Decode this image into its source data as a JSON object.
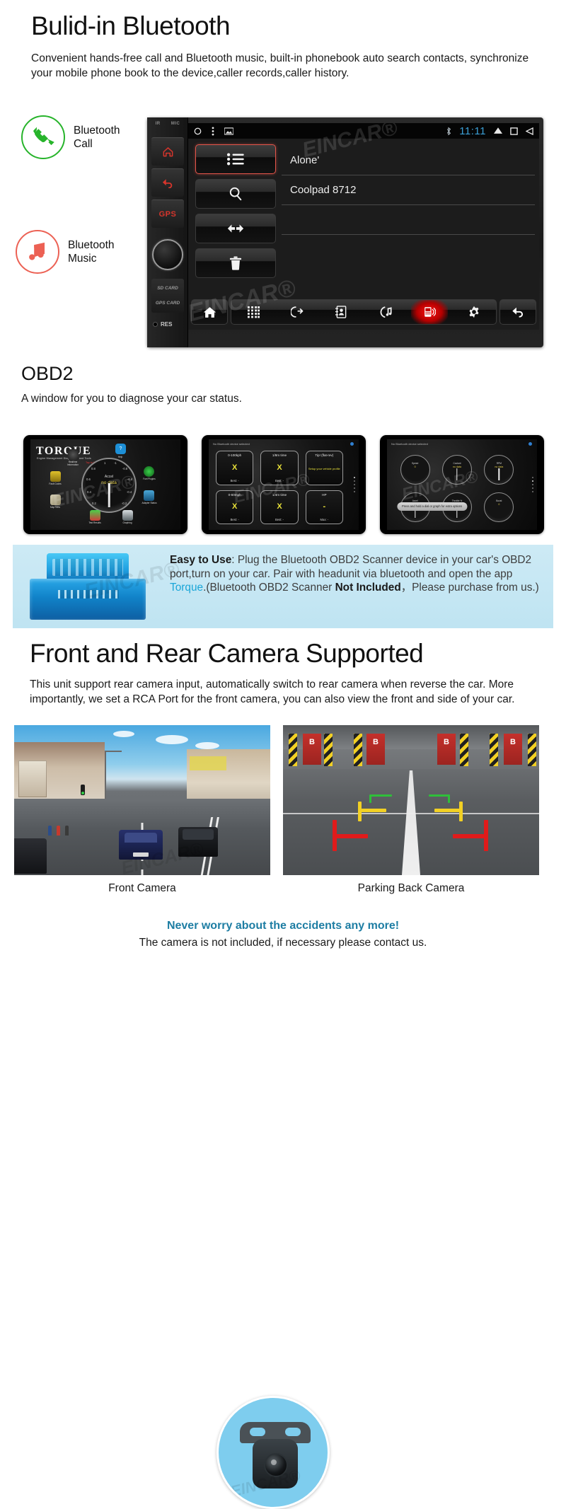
{
  "bluetooth": {
    "title": "Bulid-in Bluetooth",
    "description": "Convenient hands-free call and Bluetooth music, built-in phonebook auto search contacts, synchronize your mobile phone book to the device,caller records,caller history.",
    "features": [
      {
        "icon": "phone-handset-icon",
        "label": "Bluetooth\nCall",
        "color": "#27b42b"
      },
      {
        "icon": "music-note-icon",
        "label": "Bluetooth\nMusic",
        "color": "#ec6154"
      }
    ]
  },
  "head_unit": {
    "side_labels": {
      "ir": "IR",
      "mic": "MIC"
    },
    "hw_buttons": [
      {
        "name": "home-hw-button",
        "icon": "home-icon",
        "label": ""
      },
      {
        "name": "back-hw-button",
        "icon": "back-arrow-icon",
        "label": ""
      },
      {
        "name": "gps-hw-button",
        "icon": "",
        "label": "GPS"
      }
    ],
    "card_slots": [
      "SD CARD",
      "GPS CARD"
    ],
    "reset_label": "RES",
    "status_bar": {
      "left_icons": [
        "circle-icon",
        "more-vertical-icon",
        "gallery-icon"
      ],
      "bluetooth_icon": "bluetooth-icon",
      "time": "11:11",
      "right_icons": [
        "triangle-up-icon",
        "square-icon",
        "triangle-back-icon"
      ]
    },
    "tiles": [
      {
        "name": "paired-list-tile",
        "icon": "list-icon",
        "selected": true
      },
      {
        "name": "search-tile",
        "icon": "search-icon",
        "selected": false
      },
      {
        "name": "pair-tile",
        "icon": "pair-icon",
        "selected": false
      },
      {
        "name": "delete-tile",
        "icon": "trash-icon",
        "selected": false
      }
    ],
    "device_list": [
      "Alone'",
      "Coolpad 8712",
      ""
    ],
    "nav_bar": {
      "home": "home-icon",
      "back": "back-arrow-icon",
      "items": [
        {
          "name": "keypad-nav-icon",
          "icon": "keypad-icon",
          "active": false
        },
        {
          "name": "answer-call-nav-icon",
          "icon": "call-answer-icon",
          "active": false
        },
        {
          "name": "contacts-nav-icon",
          "icon": "contacts-book-icon",
          "active": false
        },
        {
          "name": "call-music-nav-icon",
          "icon": "call-music-icon",
          "active": false
        },
        {
          "name": "device-nav-icon",
          "icon": "mobile-device-icon",
          "active": true
        },
        {
          "name": "settings-nav-icon",
          "icon": "gear-icon",
          "active": false
        }
      ]
    },
    "watermark": "EINCAR®"
  },
  "obd2": {
    "title": "OBD2",
    "description": "A window for you to diagnose your car status.",
    "shot1": {
      "logo": "TORQUE",
      "tagline": "Engine Management Diagnostics and Tools",
      "red_note": "Tap to find info",
      "gauge_label": "Accel",
      "gauge_value": "no data",
      "ticks": [
        "1",
        "-1",
        "0.8",
        "-0.8",
        "0.6",
        "-0.6",
        "0.4",
        "-0.4",
        "0.2",
        "-0.2"
      ],
      "icons": [
        {
          "name": "realtime-information-icon",
          "caption": "Realtime Information"
        },
        {
          "name": "help-icon",
          "caption": "Help"
        },
        {
          "name": "fault-codes-icon",
          "caption": "Fault Codes"
        },
        {
          "name": "fuel-plugins-icon",
          "caption": "Fuel Plugins"
        },
        {
          "name": "map-view-icon",
          "caption": "Map View"
        },
        {
          "name": "adapter-status-icon",
          "caption": "Adapter Status"
        },
        {
          "name": "test-results-icon",
          "caption": "Test Results"
        },
        {
          "name": "graphing-icon",
          "caption": "Graphing"
        }
      ]
    },
    "shot2": {
      "top_note": "No Bluetooth device selected",
      "cells": [
        {
          "title": "0-100kph",
          "value": "X",
          "best": "Best: -"
        },
        {
          "title": "1/8m time",
          "value": "X",
          "best": "Best: -"
        },
        {
          "title": "Tip! (flat-rev)",
          "hint": "Setup your vehicle profile"
        },
        {
          "title": "0-60mph",
          "value": "X",
          "best": "Best: -"
        },
        {
          "title": "1/4m time",
          "value": "X",
          "best": "Best: -"
        },
        {
          "title": "HP",
          "value": "-",
          "best": "Max: -"
        }
      ]
    },
    "shot3": {
      "top_note": "No Bluetooth device selected",
      "tooltip": "Press and hold a dial or graph for extra options",
      "dials": [
        {
          "label": "Speed",
          "value": "0"
        },
        {
          "label": "Coolant",
          "value": "no data"
        },
        {
          "label": "RPM",
          "value": "no data"
        },
        {
          "label": "Accel",
          "value": "no data"
        },
        {
          "label": "Throttle %",
          "value": "0"
        },
        {
          "label": "Boost",
          "value": "0"
        }
      ]
    }
  },
  "banner": {
    "lead": "Easy to Use",
    "text_1": ": Plug the Bluetooth OBD2 Scanner device in your car's OBD2 port,turn on your car. Pair with headunit via bluetooth and open the app ",
    "torque": "Torque",
    "text_2": ".(Bluetooth OBD2 Scanner ",
    "not_included": "Not Included",
    "text_3": "，Please purchase from us.)",
    "dongle_icon": "obd2-dongle-icon"
  },
  "camera": {
    "title": "Front and Rear Camera Supported",
    "description": "This unit support rear camera input, automatically switch to rear camera when reverse the car. More importantly, we set a RCA Port for the front camera, you can also view the front and side of your car.",
    "front_label": "Front Camera",
    "rear_label": "Parking Back Camera",
    "garage_markers": [
      "B",
      "B",
      "B",
      "B"
    ],
    "guideline_colors": {
      "near": "#e01b1b",
      "mid": "#f2d024",
      "far": "#2fbf3a"
    },
    "inset_icon": "reversing-camera-icon"
  },
  "footer": {
    "headline": "Never worry about the accidents any more!",
    "subline": "The camera is not included, if necessary please contact us.",
    "headline_color": "#1d7da3"
  }
}
